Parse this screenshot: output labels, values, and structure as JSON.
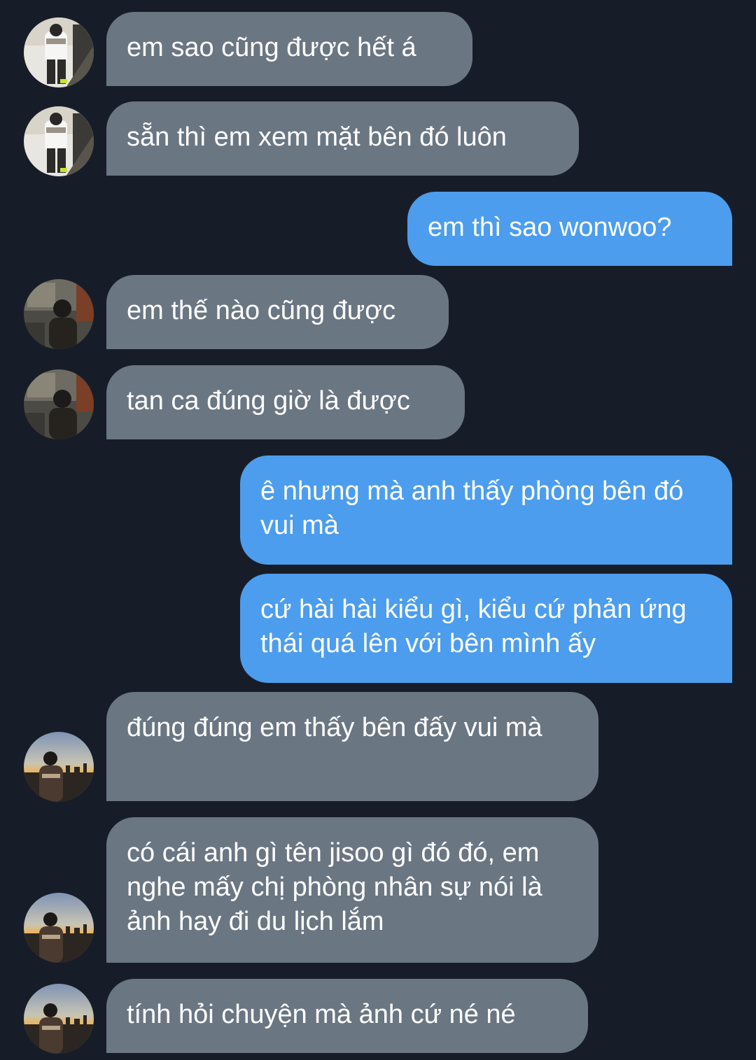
{
  "conversation": {
    "messages": [
      {
        "sender": "other",
        "avatar": "avatar-a",
        "text": "em sao cũng được hết á"
      },
      {
        "sender": "other",
        "avatar": "avatar-a",
        "text": "sẵn thì em xem mặt bên đó luôn"
      },
      {
        "sender": "me",
        "text": "em thì sao wonwoo?"
      },
      {
        "sender": "other",
        "avatar": "avatar-b",
        "text": "em thế nào cũng được"
      },
      {
        "sender": "other",
        "avatar": "avatar-b",
        "text": "tan ca đúng giờ là được"
      },
      {
        "sender": "me",
        "text": "ê nhưng mà anh thấy phòng bên đó vui mà"
      },
      {
        "sender": "me",
        "text": "cứ hài hài kiểu gì, kiểu cứ phản ứng thái quá lên với bên mình ấy"
      },
      {
        "sender": "other",
        "avatar": "avatar-c",
        "text": "đúng đúng em thấy bên đấy vui mà"
      },
      {
        "sender": "other",
        "avatar": "avatar-c",
        "text": "có cái anh gì tên jisoo gì đó đó, em nghe mấy chị phòng nhân sự nói là ảnh hay đi du lịch lắm"
      },
      {
        "sender": "other",
        "avatar": "avatar-c",
        "text": "tính hỏi chuyện mà ảnh cứ né né"
      }
    ]
  },
  "colors": {
    "background": "#171d28",
    "incoming_bubble": "#6b7683",
    "outgoing_bubble": "#4c9ded",
    "text": "#ffffff"
  }
}
